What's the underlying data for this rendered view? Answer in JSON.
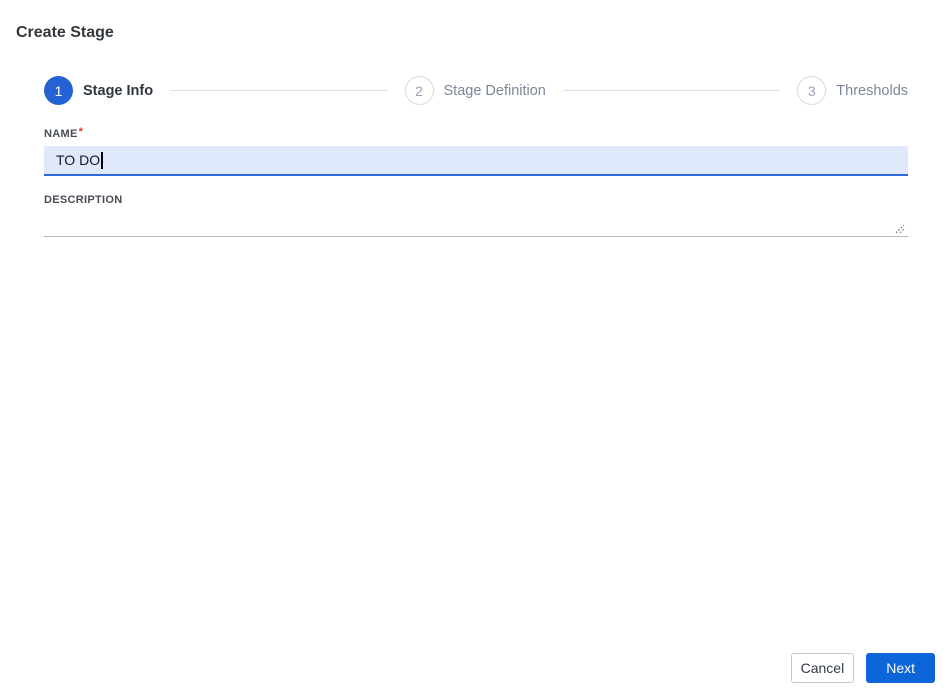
{
  "page": {
    "title": "Create Stage"
  },
  "stepper": {
    "steps": [
      {
        "number": "1",
        "label": "Stage Info",
        "state": "active"
      },
      {
        "number": "2",
        "label": "Stage Definition",
        "state": "inactive"
      },
      {
        "number": "3",
        "label": "Thresholds",
        "state": "inactive"
      }
    ]
  },
  "form": {
    "name": {
      "label": "NAME",
      "required_marker": "*",
      "value": "TO DO"
    },
    "description": {
      "label": "DESCRIPTION",
      "value": ""
    }
  },
  "footer": {
    "cancel_label": "Cancel",
    "next_label": "Next"
  },
  "colors": {
    "step_active_blue": "#2563d4",
    "next_button_blue": "#0c66d9",
    "input_focus_bg": "#dfe9fb",
    "input_focus_border": "#3068d8",
    "required_red": "#e0402f",
    "inactive_gray": "#7d8799",
    "connector_gray": "#dce0e6"
  }
}
